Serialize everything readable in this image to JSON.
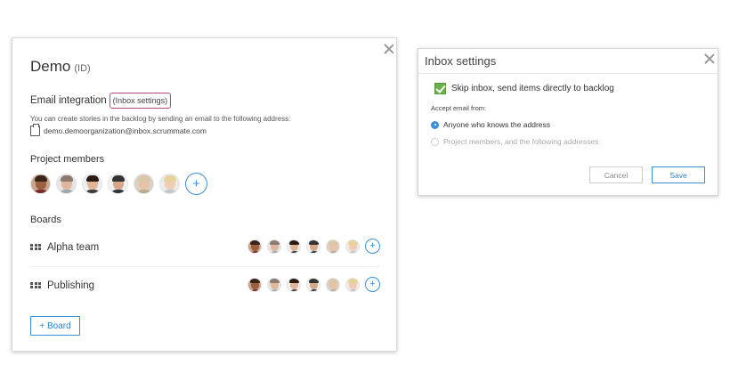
{
  "project": {
    "title": "Demo",
    "id_label": "(ID)"
  },
  "email": {
    "label": "Email integration",
    "settings_link": "(Inbox settings)",
    "description": "You can create stories in the backlog by sending an email to the following address:",
    "address": "demo.demoorganization@inbox.scrummate.com"
  },
  "members": {
    "label": "Project members",
    "add_label": "+"
  },
  "boards": {
    "label": "Boards",
    "items": [
      {
        "name": "Alpha team",
        "add_label": "+"
      },
      {
        "name": "Publishing",
        "add_label": "+"
      }
    ],
    "add_button": "+ Board"
  },
  "inbox_dialog": {
    "title": "Inbox settings",
    "skip_label": "Skip inbox, send items directly to backlog",
    "skip_checked": true,
    "accept_label": "Accept email from:",
    "options": [
      {
        "label": "Anyone who knows the address",
        "selected": true
      },
      {
        "label": "Project members, and the following addresses:",
        "selected": false
      }
    ],
    "cancel_label": "Cancel",
    "save_label": "Save"
  },
  "colors": {
    "accent": "#3a8fd9",
    "highlight_border": "#b04a7e",
    "checkbox_green": "#6ab04c"
  }
}
